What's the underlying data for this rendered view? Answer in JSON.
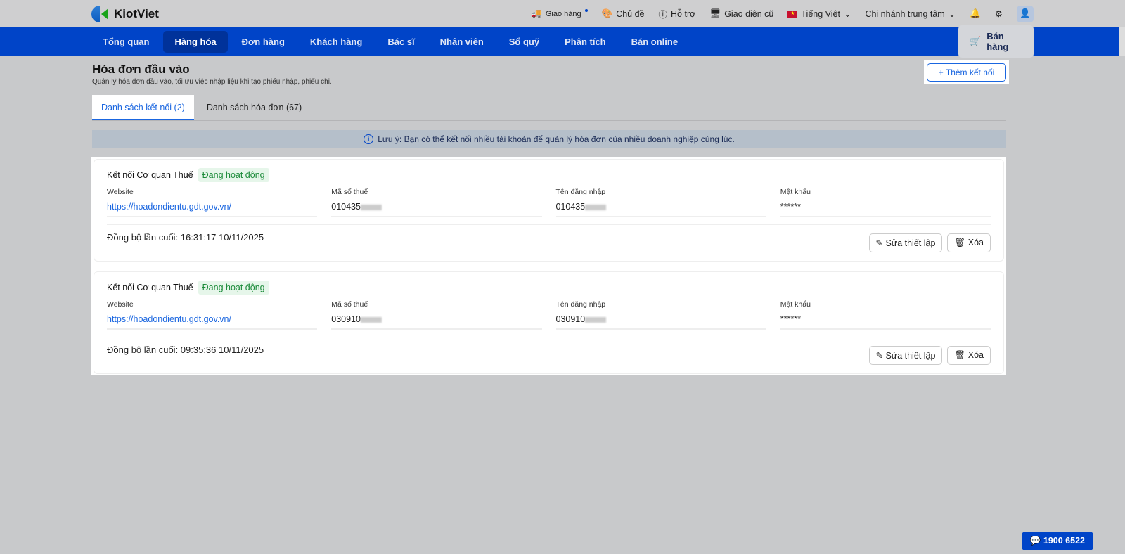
{
  "app": {
    "name": "KiotViet"
  },
  "topbar": {
    "delivery": "Giao hàng",
    "theme": "Chủ đề",
    "support": "Hỗ trợ",
    "old_ui": "Giao diện cũ",
    "language": "Tiếng Việt",
    "branch": "Chi nhánh trung tâm"
  },
  "nav": {
    "items": [
      "Tổng quan",
      "Hàng hóa",
      "Đơn hàng",
      "Khách hàng",
      "Bác sĩ",
      "Nhân viên",
      "Sổ quỹ",
      "Phân tích",
      "Bán online"
    ],
    "sell": "Bán hàng"
  },
  "page": {
    "title": "Hóa đơn đầu vào",
    "subtitle": "Quản lý hóa đơn đầu vào, tối ưu việc nhập liệu khi tạo phiếu nhập, phiếu chi.",
    "add_button": "Thêm kết nối"
  },
  "tabs": [
    "Danh sách kết nối (2)",
    "Danh sách hóa đơn (67)"
  ],
  "note": "Lưu ý: Bạn có thể kết nối nhiều tài khoản để quản lý hóa đơn của nhiều doanh nghiệp cùng lúc.",
  "labels": {
    "website": "Website",
    "tax": "Mã số thuế",
    "user": "Tên đăng nhập",
    "password": "Mật khẩu",
    "edit": "Sửa thiết lập",
    "delete": "Xóa"
  },
  "connections": [
    {
      "title": "Kết nối Cơ quan Thuế",
      "status": "Đang hoạt động",
      "website": "https://hoadondientu.gdt.gov.vn/",
      "tax": "010435",
      "user": "010435",
      "password": "******",
      "sync": "Đồng bộ lần cuối: 16:31:17 10/11/2025"
    },
    {
      "title": "Kết nối Cơ quan Thuế",
      "status": "Đang hoạt động",
      "website": "https://hoadondientu.gdt.gov.vn/",
      "tax": "030910",
      "user": "030910",
      "password": "******",
      "sync": "Đồng bộ lần cuối: 09:35:36 10/11/2025"
    }
  ],
  "hotline": "1900 6522"
}
